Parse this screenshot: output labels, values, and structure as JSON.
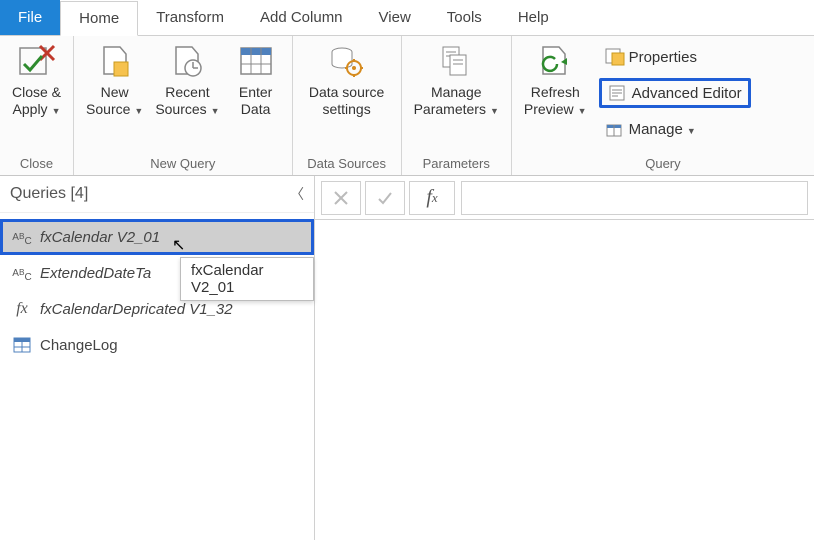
{
  "tabs": {
    "file": "File",
    "home": "Home",
    "transform": "Transform",
    "add_column": "Add Column",
    "view": "View",
    "tools": "Tools",
    "help": "Help"
  },
  "ribbon": {
    "close": {
      "close_apply_l1": "Close &",
      "close_apply_l2": "Apply",
      "group_label": "Close"
    },
    "new_query": {
      "new_source_l1": "New",
      "new_source_l2": "Source",
      "recent_sources_l1": "Recent",
      "recent_sources_l2": "Sources",
      "enter_data_l1": "Enter",
      "enter_data_l2": "Data",
      "group_label": "New Query"
    },
    "data_sources": {
      "data_source_l1": "Data source",
      "data_source_l2": "settings",
      "group_label": "Data Sources"
    },
    "parameters": {
      "manage_l1": "Manage",
      "manage_l2": "Parameters",
      "group_label": "Parameters"
    },
    "query": {
      "refresh_l1": "Refresh",
      "refresh_l2": "Preview",
      "properties": "Properties",
      "advanced_editor": "Advanced Editor",
      "manage": "Manage",
      "group_label": "Query"
    }
  },
  "queries": {
    "header": "Queries [4]",
    "items": [
      {
        "name": "fxCalendar V2_01",
        "type": "abc"
      },
      {
        "name": "ExtendedDateTa",
        "type": "abc"
      },
      {
        "name": "fxCalendarDepricated V1_32",
        "type": "fx"
      },
      {
        "name": "ChangeLog",
        "type": "table"
      }
    ],
    "tooltip": "fxCalendar V2_01"
  },
  "formula_bar": {
    "value": ""
  }
}
